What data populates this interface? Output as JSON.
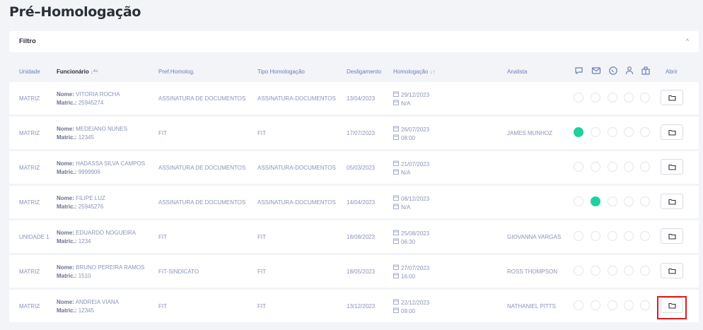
{
  "page": {
    "title": "Pré–Homologação"
  },
  "filter": {
    "label": "Filtro",
    "chevron": "^"
  },
  "header": {
    "unidade": "Unidade",
    "funcionario": "Funcionário",
    "pref_homolog": "Pref.Homolog.",
    "tipo_homologacao": "Tipo Homologação",
    "desligamento": "Desligamento",
    "homologacao": "Homologação",
    "analista": "Analista",
    "abrir": "Abrir",
    "channel_icons": [
      "chat-icon",
      "mail-icon",
      "whatsapp-icon",
      "person-icon",
      "building-icon"
    ]
  },
  "labels": {
    "nome": "Nome:",
    "matric": "Matric.:"
  },
  "rows": [
    {
      "unidade": "MATRIZ",
      "nome": "VITORIA ROCHA",
      "matric": "25945274",
      "pref": "ASSINATURA DE DOCUMENTOS",
      "tipo": "ASSINATURA-DOCUMENTOS",
      "desligamento": "13/04/2023",
      "data": "29/12/2023",
      "hora": "N/A",
      "analista": "",
      "status": [
        false,
        false,
        false,
        false,
        false
      ]
    },
    {
      "unidade": "MATRIZ",
      "nome": "MEDEIANO NUNES",
      "matric": "12345",
      "pref": "FIT",
      "tipo": "FIT",
      "desligamento": "17/07/2023",
      "data": "26/07/2023",
      "hora": "08:00",
      "analista": "JAMES MUNHOZ",
      "status": [
        true,
        false,
        false,
        false,
        false
      ]
    },
    {
      "unidade": "MATRIZ",
      "nome": "HADASSA SILVA CAMPOS",
      "matric": "9999906",
      "pref": "ASSINATURA DE DOCUMENTOS",
      "tipo": "ASSINATURA-DOCUMENTOS",
      "desligamento": "05/03/2023",
      "data": "21/07/2023",
      "hora": "N/A",
      "analista": "",
      "status": [
        false,
        false,
        false,
        false,
        false
      ]
    },
    {
      "unidade": "MATRIZ",
      "nome": "FILIPE LUZ",
      "matric": "25945276",
      "pref": "ASSINATURA DE DOCUMENTOS",
      "tipo": "ASSINATURA-DOCUMENTOS",
      "desligamento": "14/04/2023",
      "data": "08/12/2023",
      "hora": "N/A",
      "analista": "",
      "status": [
        false,
        true,
        false,
        false,
        false
      ]
    },
    {
      "unidade": "UNIDADE 1",
      "nome": "EDUARDO NOGUEIRA",
      "matric": "1234",
      "pref": "FIT",
      "tipo": "FIT",
      "desligamento": "18/08/2023",
      "data": "25/08/2023",
      "hora": "06:30",
      "analista": "GIOVANNA VARGAS",
      "status": [
        false,
        false,
        false,
        false,
        false
      ]
    },
    {
      "unidade": "MATRIZ",
      "nome": "BRUNO PEREIRA RAMOS",
      "matric": "1510",
      "pref": "FIT-SINDICATO",
      "tipo": "FIT",
      "desligamento": "18/05/2023",
      "data": "27/07/2023",
      "hora": "16:00",
      "analista": "ROSS THOMPSON",
      "status": [
        false,
        false,
        false,
        false,
        false
      ]
    },
    {
      "unidade": "MATRIZ",
      "nome": "ANDREIA VIANA",
      "matric": "12345",
      "pref": "FIT",
      "tipo": "FIT",
      "desligamento": "13/12/2023",
      "data": "22/12/2023",
      "hora": "09:00",
      "analista": "NATHANIEL PITTS",
      "status": [
        false,
        false,
        false,
        false,
        false
      ]
    }
  ],
  "colors": {
    "accent_green": "#1fd19e",
    "highlight_red": "#e0191b"
  }
}
